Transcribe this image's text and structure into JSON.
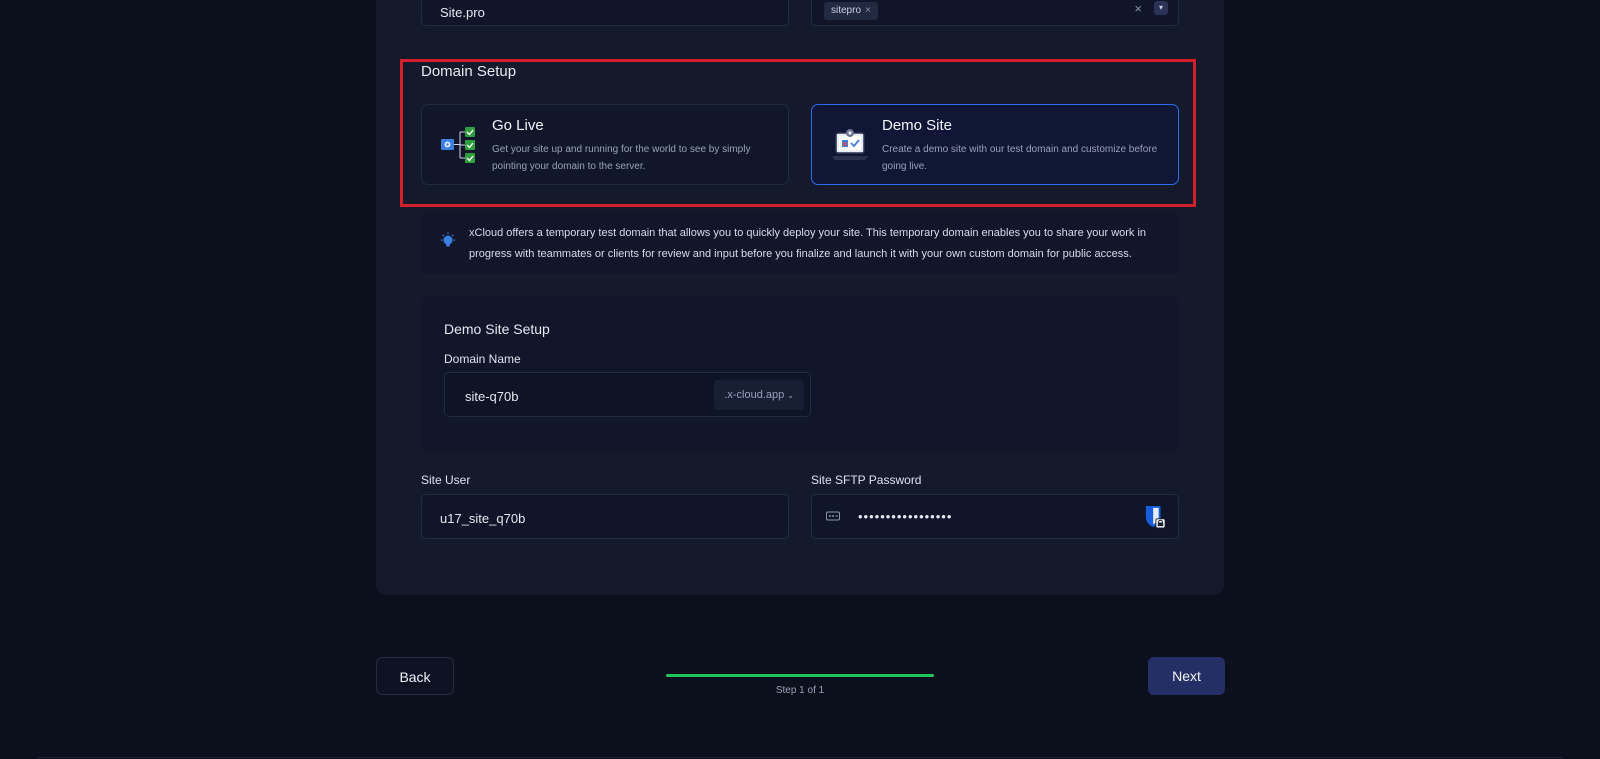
{
  "top_fields": {
    "site_title_value": "Site.pro",
    "tags": [
      "sitepro"
    ],
    "tag_remove": "×",
    "clear": "×",
    "toggle": "▾"
  },
  "domain_setup": {
    "title": "Domain Setup",
    "options": [
      {
        "title": "Go Live",
        "description": "Get your site up and running for the world to see by simply pointing your domain to the server.",
        "icon": "checklist-icon",
        "selected": false
      },
      {
        "title": "Demo Site",
        "description": "Create a demo site with our test domain and customize before going live.",
        "icon": "laptop-settings-icon",
        "selected": true
      }
    ]
  },
  "info": {
    "icon": "lightbulb-icon",
    "text": "xCloud offers a temporary test domain that allows you to quickly deploy your site. This temporary domain enables you to share your work in progress with teammates or clients for review and input before you finalize and launch it with your own custom domain for public access."
  },
  "demo_setup": {
    "title": "Demo Site Setup",
    "domain_label": "Domain Name",
    "domain_value": "site-q70b",
    "domain_suffix": ".x-cloud.app"
  },
  "site_user": {
    "label": "Site User",
    "value": "u17_site_q70b"
  },
  "sftp": {
    "label": "Site SFTP Password",
    "value": "•••••••••••••••••"
  },
  "footer": {
    "back_label": "Back",
    "next_label": "Next",
    "step_text": "Step 1 of 1",
    "progress": 1.0
  },
  "colors": {
    "background": "#0c0f1c",
    "card": "#141a2b",
    "selected_border": "#2d6cf0",
    "highlight": "#d61f2c",
    "progress": "#21c55d",
    "next_button": "#243065"
  }
}
